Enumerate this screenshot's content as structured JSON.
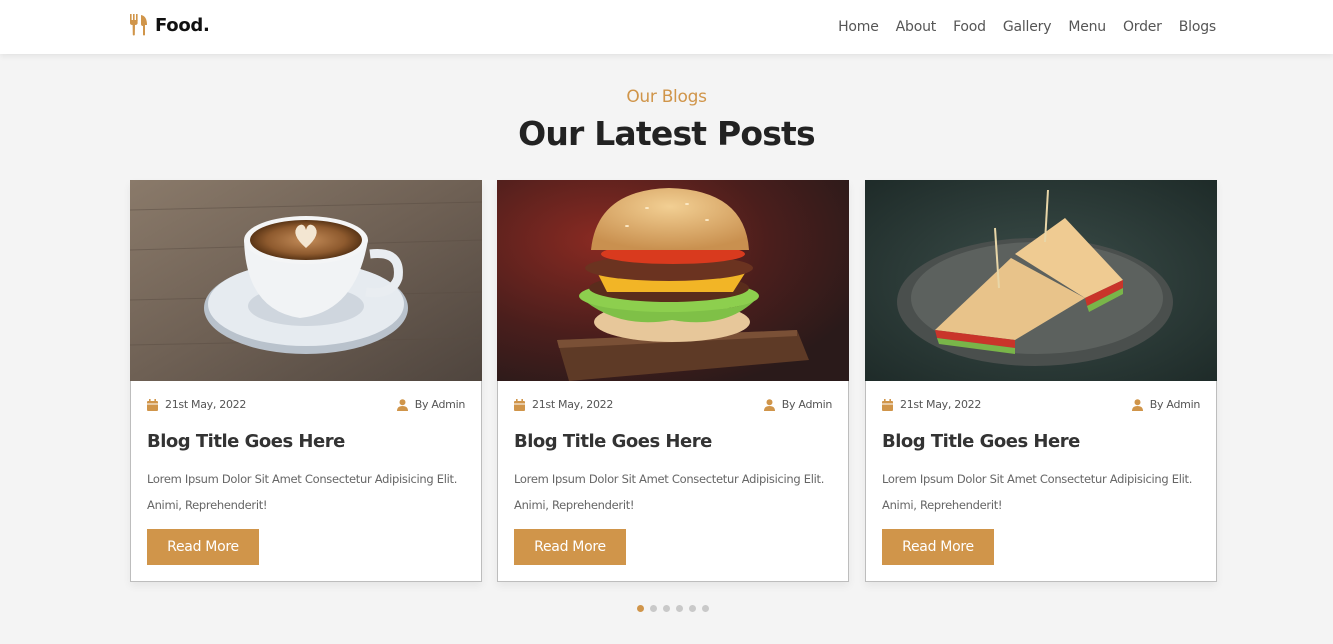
{
  "brand": {
    "name": "Food."
  },
  "nav": [
    "Home",
    "About",
    "Food",
    "Gallery",
    "Menu",
    "Order",
    "Blogs"
  ],
  "section": {
    "subtitle": "Our Blogs",
    "title": "Our Latest Posts"
  },
  "posts": [
    {
      "image": "coffee-cup-photo",
      "date": "21st May, 2022",
      "author": "By Admin",
      "title": "Blog Title Goes Here",
      "text": "Lorem Ipsum Dolor Sit Amet Consectetur Adipisicing Elit. Animi, Reprehenderit!",
      "button": "Read More"
    },
    {
      "image": "burger-photo",
      "date": "21st May, 2022",
      "author": "By Admin",
      "title": "Blog Title Goes Here",
      "text": "Lorem Ipsum Dolor Sit Amet Consectetur Adipisicing Elit. Animi, Reprehenderit!",
      "button": "Read More"
    },
    {
      "image": "sandwich-photo",
      "date": "21st May, 2022",
      "author": "By Admin",
      "title": "Blog Title Goes Here",
      "text": "Lorem Ipsum Dolor Sit Amet Consectetur Adipisicing Elit. Animi, Reprehenderit!",
      "button": "Read More"
    }
  ],
  "pagination": {
    "count": 6,
    "active": 1
  },
  "colors": {
    "accent": "#d0954a",
    "background": "#f4f4f4",
    "text": "#222222"
  },
  "icons": {
    "brand": "utensils-icon",
    "date": "calendar-icon",
    "author": "user-icon"
  }
}
